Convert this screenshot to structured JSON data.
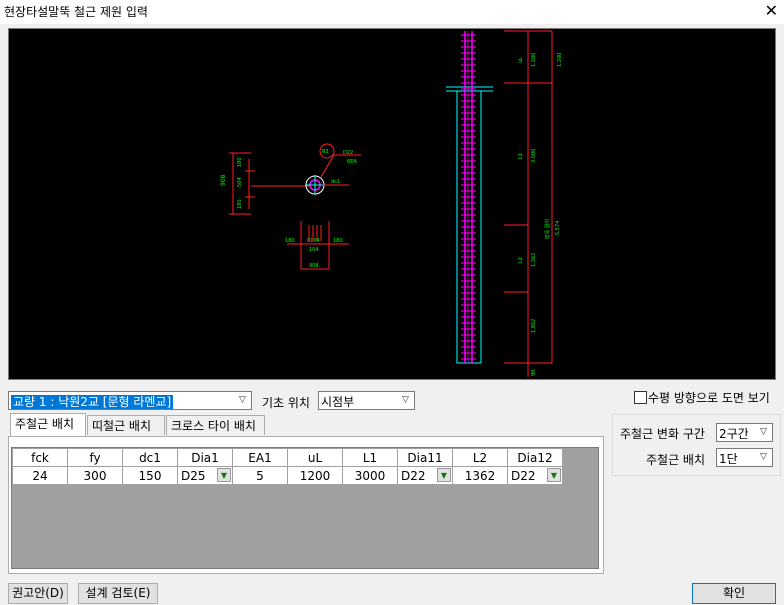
{
  "window": {
    "title": "현장타설말뚝 철근 제원 입력",
    "close_glyph": "✕"
  },
  "drawing": {
    "plan": {
      "left_dim": "908",
      "left_sub": [
        "180",
        "504",
        "180"
      ],
      "bottom_dims": [
        "180",
        "0104",
        "180"
      ],
      "bottom_sub": "104",
      "bottom_total": "908",
      "rebar_tag": "R3",
      "rebar_label": "D22",
      "rebar_count": "6EA",
      "dc_label": "dc1"
    },
    "elevation": {
      "segments": [
        {
          "code": "uL",
          "value": "1.200",
          "note": "1.200"
        },
        {
          "code": "L1",
          "value": "3.000"
        },
        {
          "code": "L2",
          "value": "1.362"
        },
        {
          "code": "",
          "value": "1.862"
        },
        {
          "code": "",
          "value": "90"
        }
      ],
      "total_label": "말뚝 길이",
      "total_value": "5.574"
    }
  },
  "bridge_select": {
    "value": "교량 1 : 낙원2교 [문형 라멘교]"
  },
  "foundation": {
    "label": "기초 위치",
    "value": "시점부"
  },
  "horizontal_view": {
    "label": "수평 방향으로 도면 보기",
    "checked": false
  },
  "tabs": [
    {
      "label": "주철근 배치",
      "active": true
    },
    {
      "label": "띠철근 배치",
      "active": false
    },
    {
      "label": "크로스 타이 배치",
      "active": false
    }
  ],
  "table": {
    "headers": [
      "fck",
      "fy",
      "dc1",
      "Dia1",
      "EA1",
      "uL",
      "L1",
      "Dia11",
      "L2",
      "Dia12"
    ],
    "rows": [
      [
        "24",
        "300",
        "150",
        "D25",
        "5",
        "1200",
        "3000",
        "D22",
        "1362",
        "D22"
      ]
    ]
  },
  "rebar_zone": {
    "label": "주철근 변화 구간",
    "value": "2구간"
  },
  "rebar_layout": {
    "label": "주철근 배치",
    "value": "1단"
  },
  "buttons": {
    "recommend": "권고안(D)",
    "design_check": "설계 검토(E)",
    "ok": "확인"
  }
}
